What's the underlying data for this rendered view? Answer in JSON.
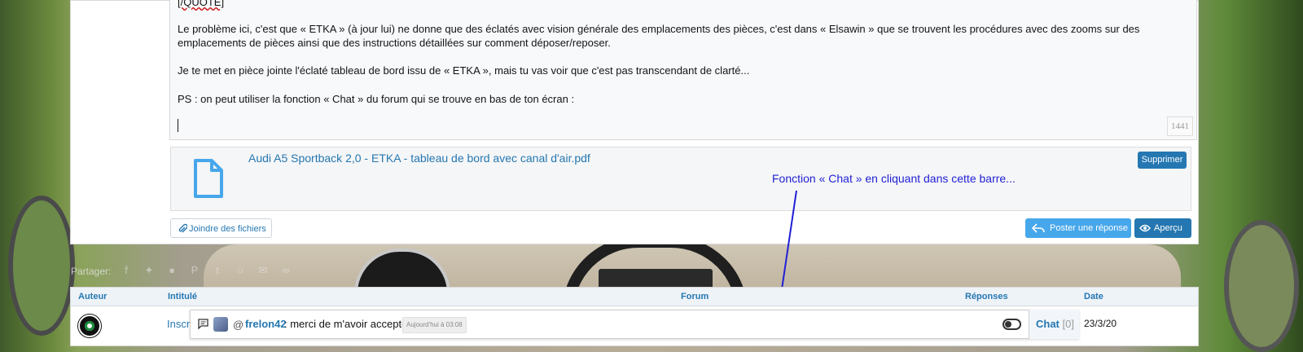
{
  "editor": {
    "quote_tag": "[/QUOTE]",
    "paragraphs": [
      "Le problème ici, c'est que « ETKA » (à jour lui) ne donne que des éclatés avec vision générale des emplacements des pièces, c'est dans « Elsawin » que se trouvent les procédures avec des zooms sur des emplacements de pièces ainsi que des instructions détaillées sur comment déposer/reposer.",
      "Je te met en pièce jointe l'éclaté tableau de bord issu de « ETKA », mais tu vas voir que c'est pas transcendant de clarté...",
      "PS : on peut utiliser la fonction « Chat » du forum qui se trouve en bas de ton écran :"
    ],
    "char_counter": "1441"
  },
  "attachment": {
    "file_name": "Audi A5 Sportback 2,0 - ETKA - tableau de bord avec canal d'air.pdf",
    "delete_label": "Supprimer"
  },
  "annotation": {
    "text": "Fonction « Chat » en cliquant dans cette barre...",
    "color": "#1f1fd6"
  },
  "actions": {
    "attach_label": "Joindre des fichiers",
    "post_label": "Poster une réponse",
    "preview_label": "Aperçu"
  },
  "share": {
    "label": "Partager:",
    "icons": [
      "facebook-icon",
      "twitter-icon",
      "reddit-icon",
      "pinterest-icon",
      "tumblr-icon",
      "whatsapp-icon",
      "email-icon",
      "link-icon"
    ]
  },
  "table": {
    "headers": [
      "Auteur",
      "Intitulé",
      "Forum",
      "Réponses",
      "Date"
    ],
    "row": {
      "title": "Inscri",
      "date": "23/3/20"
    }
  },
  "chat": {
    "at": "@",
    "username": "frelon42",
    "message": ": merci de m'avoir accepté",
    "time": "Aujourd'hui à 03:08",
    "tab_label": "Chat",
    "tab_count": "[0]"
  },
  "colors": {
    "accent": "#2577b1",
    "button_light": "#47a7eb"
  }
}
